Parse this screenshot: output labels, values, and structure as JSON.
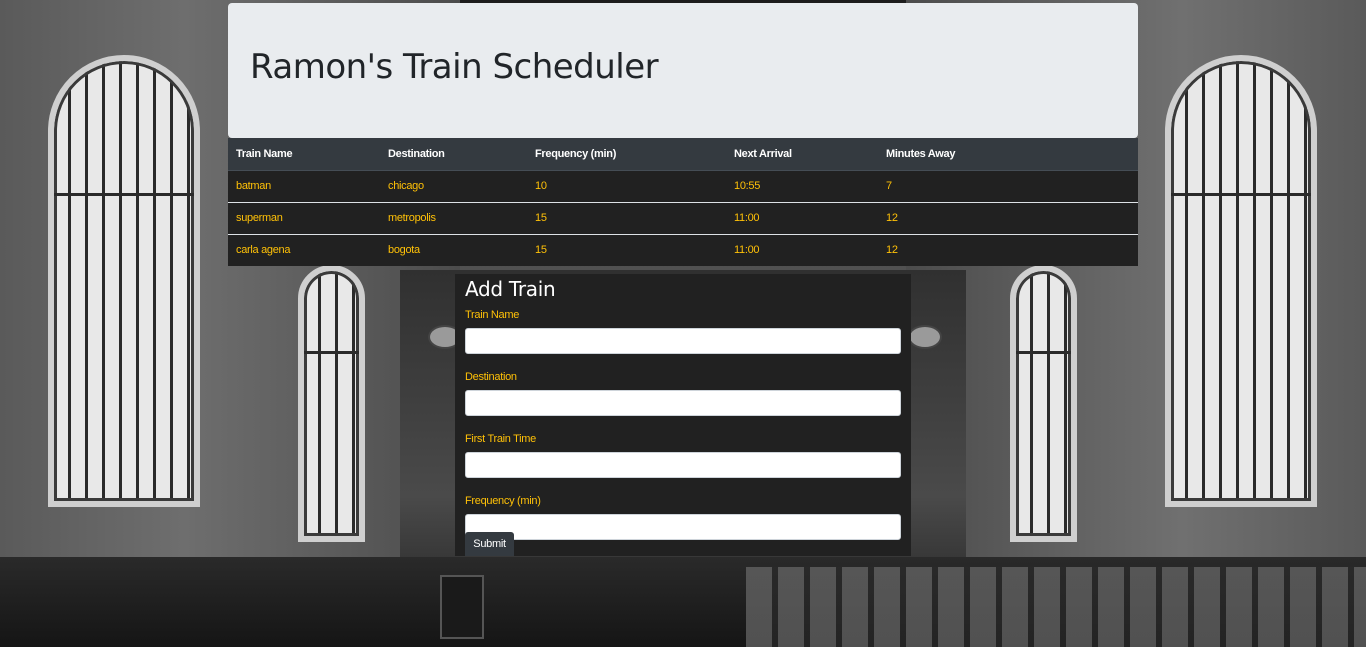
{
  "header": {
    "title": "Ramon's Train Scheduler"
  },
  "schedule": {
    "columns": [
      "Train Name",
      "Destination",
      "Frequency (min)",
      "Next Arrival",
      "Minutes Away"
    ],
    "rows": [
      [
        "batman",
        "chicago",
        "10",
        "10:55",
        "7"
      ],
      [
        "superman",
        "metropolis",
        "15",
        "11:00",
        "12"
      ],
      [
        "carla agena",
        "bogota",
        "15",
        "11:00",
        "12"
      ]
    ]
  },
  "add_train": {
    "title": "Add Train",
    "fields": [
      {
        "label": "Train Name",
        "value": "",
        "placeholder": ""
      },
      {
        "label": "Destination",
        "value": "",
        "placeholder": ""
      },
      {
        "label": "First Train Time",
        "value": "",
        "placeholder": ""
      },
      {
        "label": "Frequency (min)",
        "value": "",
        "placeholder": ""
      }
    ],
    "submit_label": "Submit"
  },
  "colors": {
    "header_bg": "#e9ecef",
    "table_bg": "#212121",
    "table_head_bg": "#343a40",
    "accent_text": "#ffc107"
  }
}
